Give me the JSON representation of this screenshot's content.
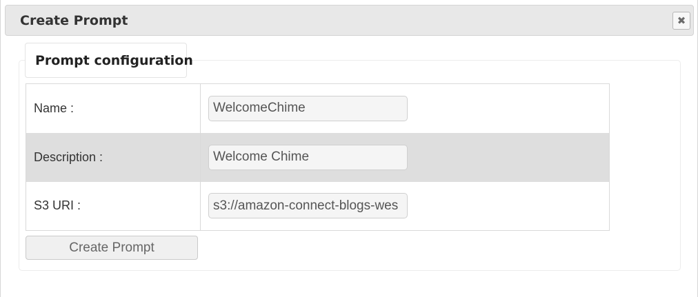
{
  "dialog": {
    "title": "Create Prompt",
    "close_icon": "close-icon",
    "close_glyph": "✖"
  },
  "tab": {
    "label": "Prompt configuration"
  },
  "form": {
    "rows": [
      {
        "label": "Name :",
        "value": "WelcomeChime"
      },
      {
        "label": "Description :",
        "value": "Welcome Chime"
      },
      {
        "label": "S3 URI :",
        "value": "s3://amazon-connect-blogs-wes"
      }
    ],
    "submit_label": "Create Prompt"
  },
  "colors": {
    "titlebar_bg": "#e8e8e8",
    "shaded_row_bg": "#dedede",
    "input_bg": "#f5f5f5"
  }
}
